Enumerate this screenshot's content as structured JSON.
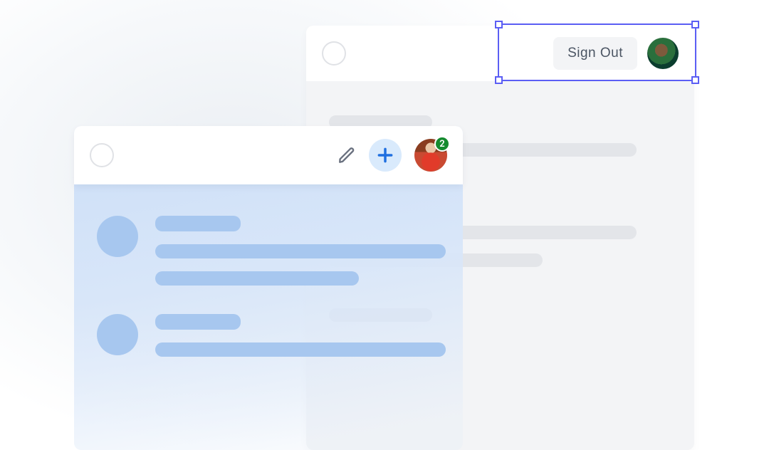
{
  "panel_grey": {
    "signout_label": "Sign Out"
  },
  "panel_blue": {
    "badge_count": "2"
  }
}
